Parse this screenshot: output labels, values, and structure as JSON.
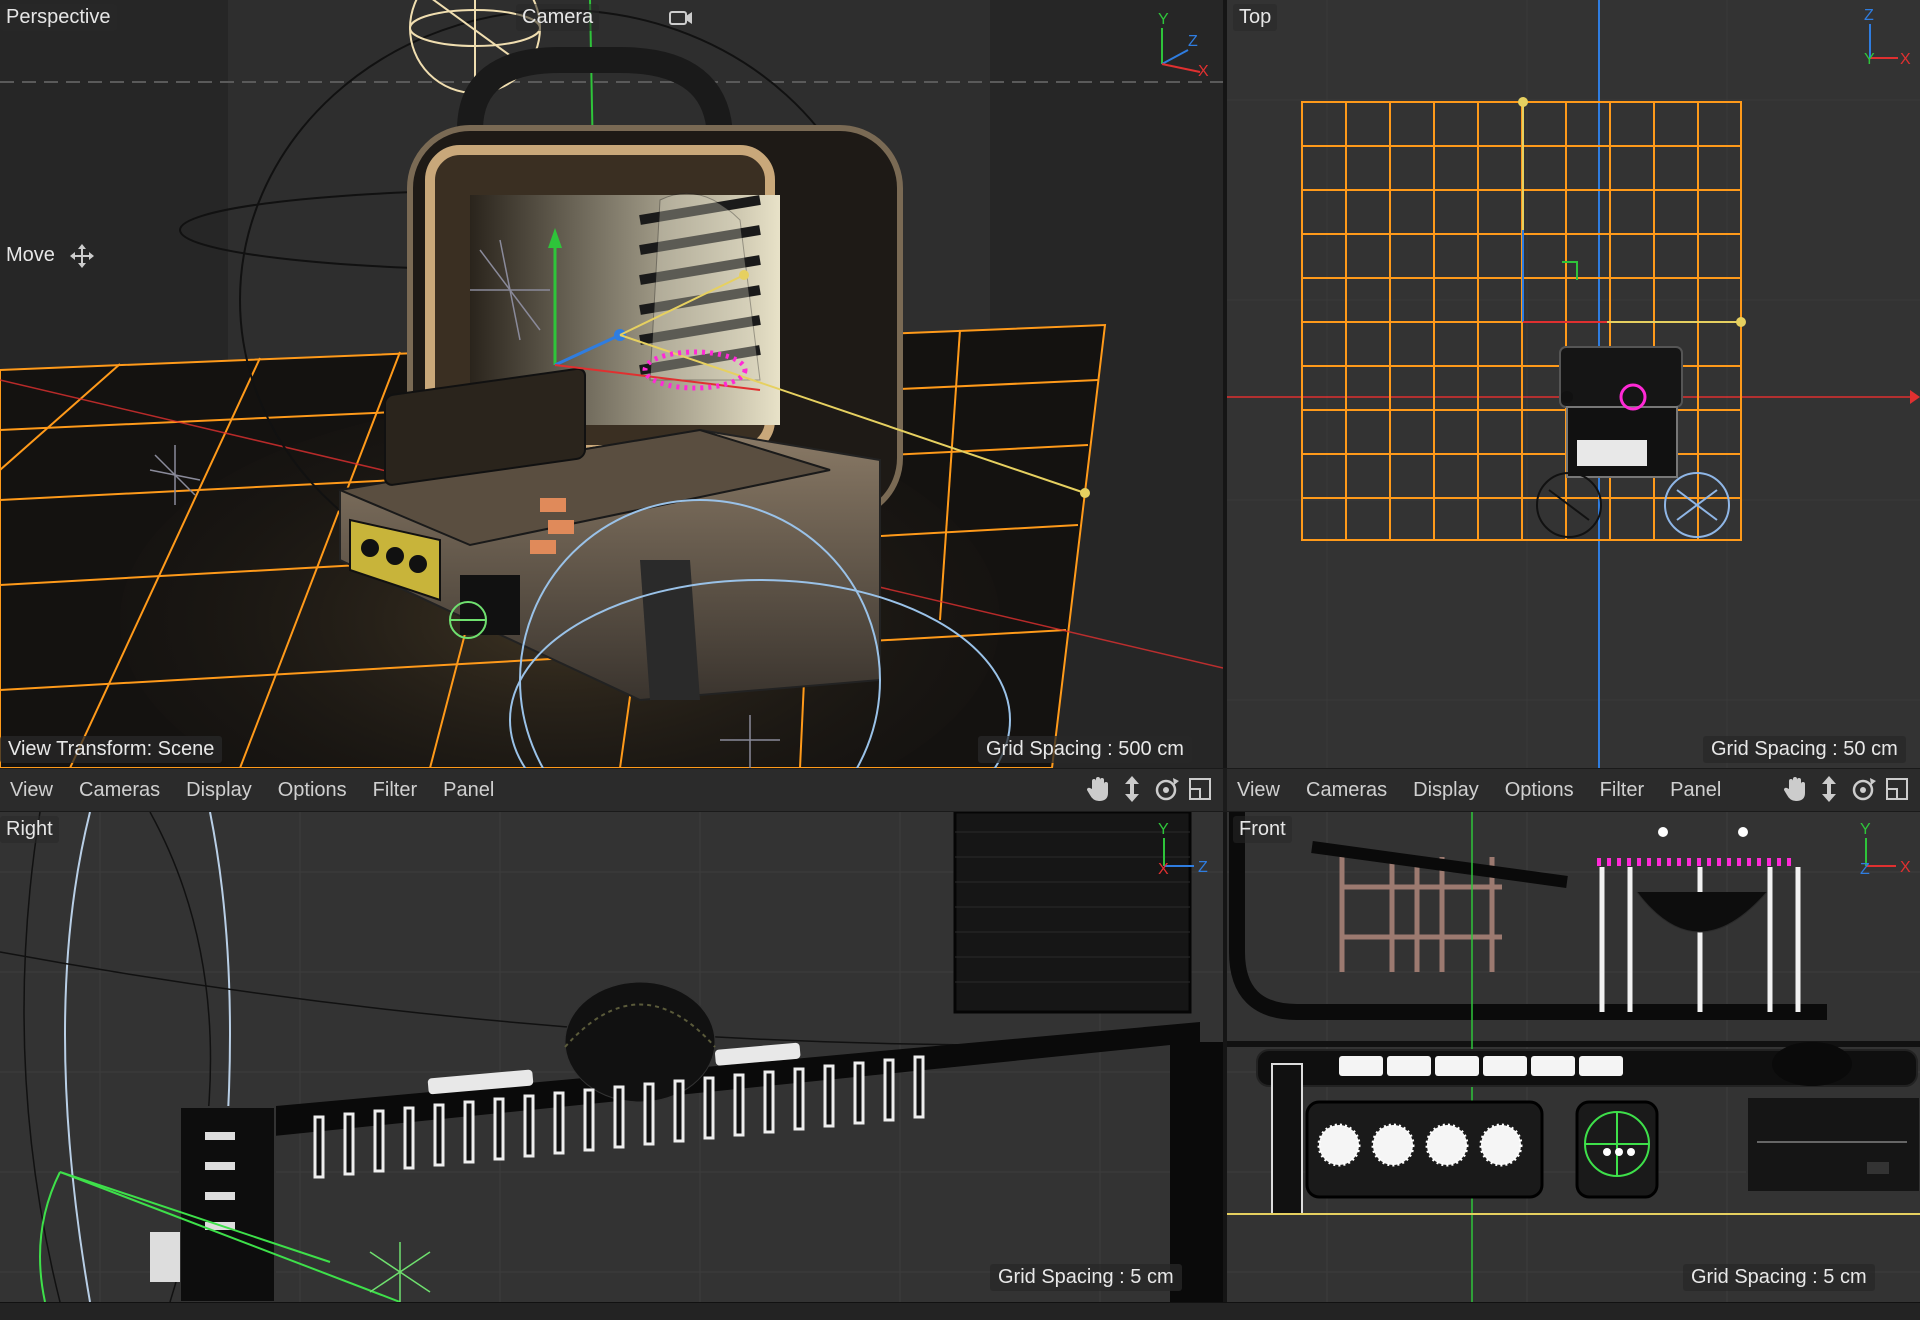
{
  "viewports": {
    "perspective": {
      "label": "Perspective",
      "camera_label": "Camera",
      "tool_label": "Move",
      "view_transform": "View Transform: Scene",
      "grid_spacing": "Grid Spacing : 500 cm",
      "axis": {
        "y": "Y",
        "z": "Z",
        "x": "X"
      }
    },
    "top": {
      "label": "Top",
      "grid_spacing": "Grid Spacing : 50 cm",
      "axis": {
        "z": "Z",
        "y": "Y",
        "x": "X"
      }
    },
    "right": {
      "label": "Right",
      "grid_spacing": "Grid Spacing : 5 cm",
      "axis": {
        "y": "Y",
        "x": "X",
        "z": "Z"
      }
    },
    "front": {
      "label": "Front",
      "grid_spacing": "Grid Spacing : 5 cm",
      "axis": {
        "y": "Y",
        "z": "Z",
        "x": "X"
      }
    }
  },
  "menus": {
    "left": [
      "View",
      "Cameras",
      "Display",
      "Options",
      "Filter",
      "Panel"
    ],
    "right": [
      "View",
      "Cameras",
      "Display",
      "Options",
      "Filter",
      "Panel"
    ]
  },
  "toolbar_icons": [
    "hand-pan-icon",
    "move-arrows-icon",
    "orbit-icon",
    "maximize-icon"
  ],
  "colors": {
    "viewport_bg": "#333333",
    "grid_orange": "#ff9a1a",
    "axis_x": "#e03030",
    "axis_y": "#2ec43a",
    "axis_z": "#2f7de0",
    "selection_magenta": "#ff29d6"
  }
}
